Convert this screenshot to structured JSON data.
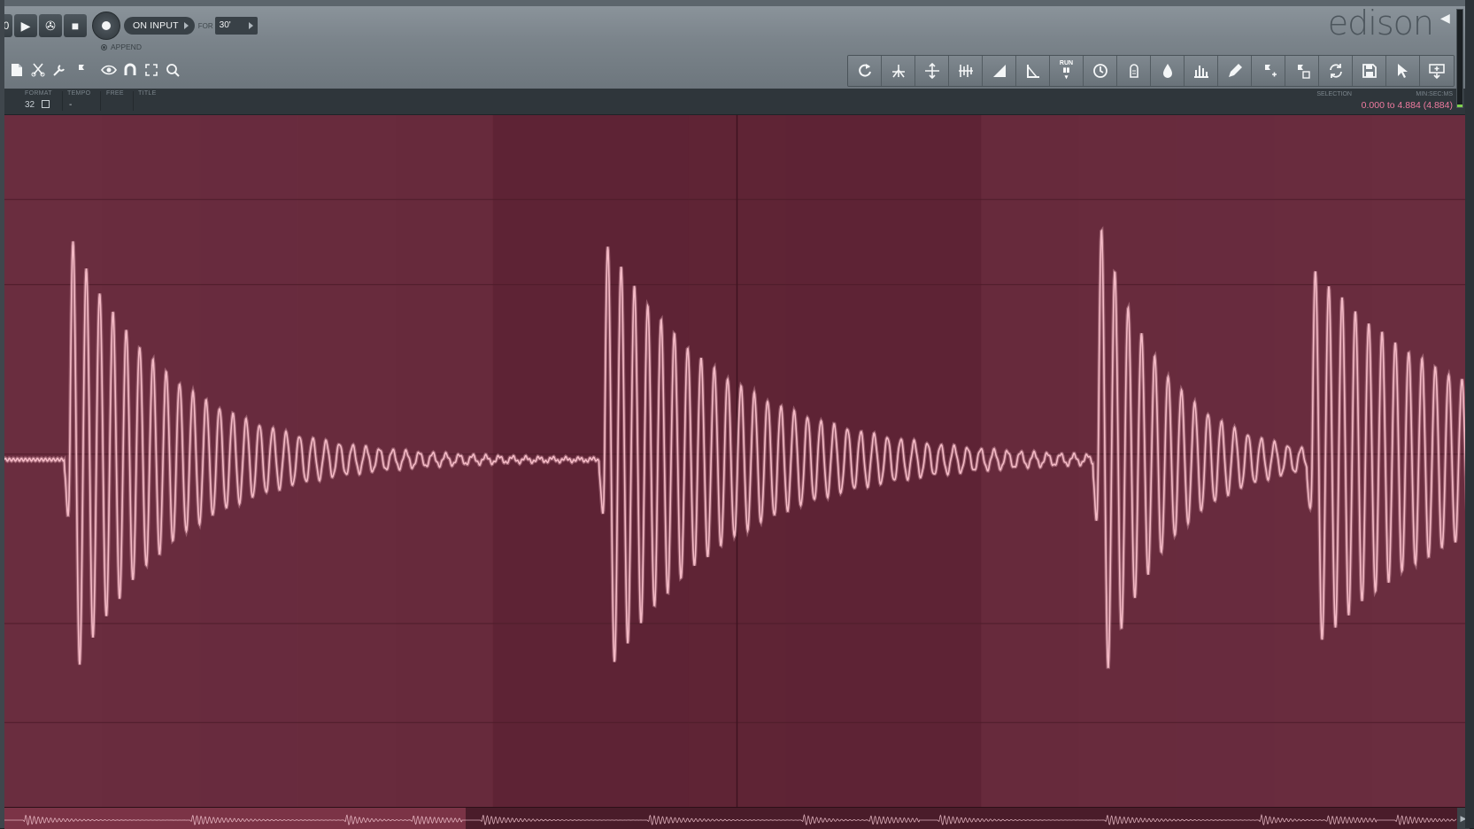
{
  "transport": {
    "counter_text": "0",
    "mode_label": "ON INPUT",
    "for_label": "FOR",
    "for_value": "30'",
    "append_label": "APPEND"
  },
  "brand": {
    "title": "edison"
  },
  "info": {
    "format_label": "FORMAT",
    "format_value": "32",
    "tempo_label": "TEMPO",
    "tempo_value": "-",
    "free_label": "FREE",
    "title_label": "TITLE",
    "selection_label": "SELECTION",
    "units_label": "MIN:SEC:MS",
    "selection_value": "0.000 to 4.884 (4.884)"
  },
  "toolbar_icons": [
    "reload-icon",
    "tune-icon",
    "normalize-icon",
    "denoise-icon",
    "fade-in-icon",
    "fade-out-icon",
    "run-icon",
    "timestretch-icon",
    "blur-icon",
    "drop-icon",
    "spectrum-icon",
    "pen-icon",
    "add-marker-icon",
    "region-marker-icon",
    "loop-icon",
    "save-icon",
    "select-icon",
    "send-to-playlist-icon"
  ],
  "small_tools": [
    "file-icon",
    "cut-icon",
    "wrench-icon",
    "marker-icon",
    "eye-icon",
    "magnet-icon",
    "fit-icon",
    "zoom-icon"
  ],
  "colors": {
    "wave_bg": "#5f2435",
    "wave_alt": "#6a2d3f",
    "wave_line": "#f4b9c5",
    "selection_text": "#f07ba0"
  },
  "waveform": {
    "hits": [
      {
        "time": 0.045,
        "amplitude": 0.95,
        "decay": 0.07
      },
      {
        "time": 0.41,
        "amplitude": 0.93,
        "decay": 0.085
      },
      {
        "time": 0.747,
        "amplitude": 1.0,
        "decay": 0.045
      },
      {
        "time": 0.893,
        "amplitude": 0.78,
        "decay": 0.12
      }
    ],
    "overview_visible_fraction": 0.315
  }
}
